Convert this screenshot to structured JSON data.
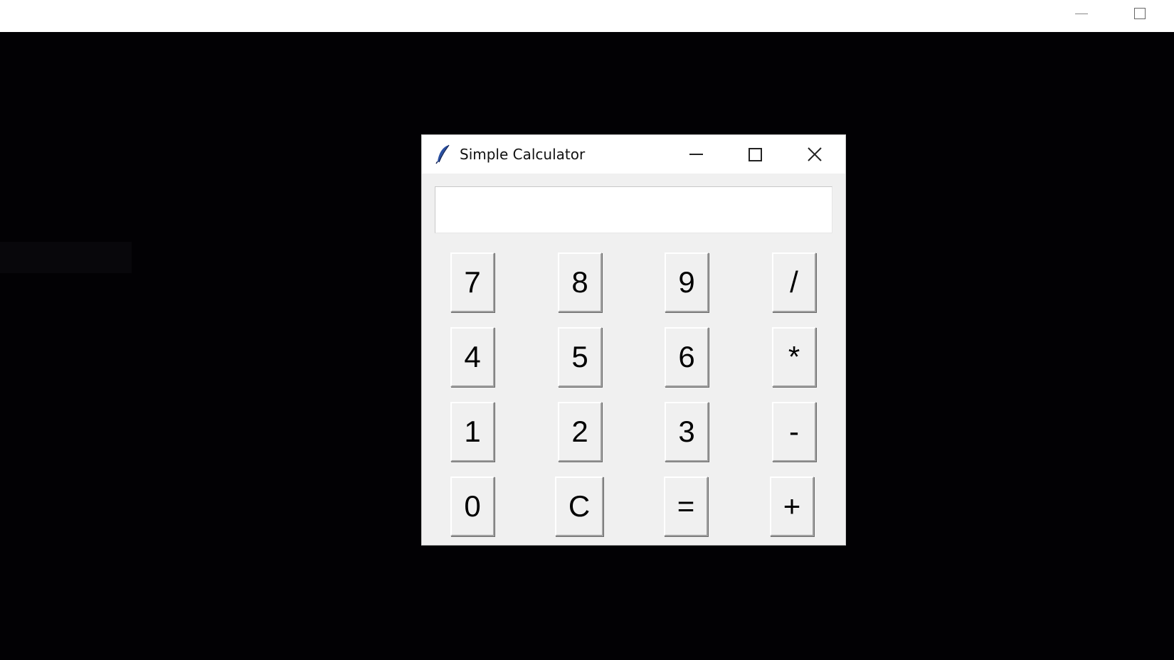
{
  "window": {
    "title": "Simple Calculator",
    "icon": "feather-icon"
  },
  "display": {
    "value": "",
    "placeholder": ""
  },
  "keys": [
    [
      "7",
      "8",
      "9",
      "/"
    ],
    [
      "4",
      "5",
      "6",
      "*"
    ],
    [
      "1",
      "2",
      "3",
      "-"
    ],
    [
      "0",
      "C",
      "=",
      "+"
    ]
  ],
  "colors": {
    "background": "#020104",
    "window": "#f0f0f0",
    "titlebar": "#ffffff",
    "feather_icon": "#2a4fa0"
  }
}
